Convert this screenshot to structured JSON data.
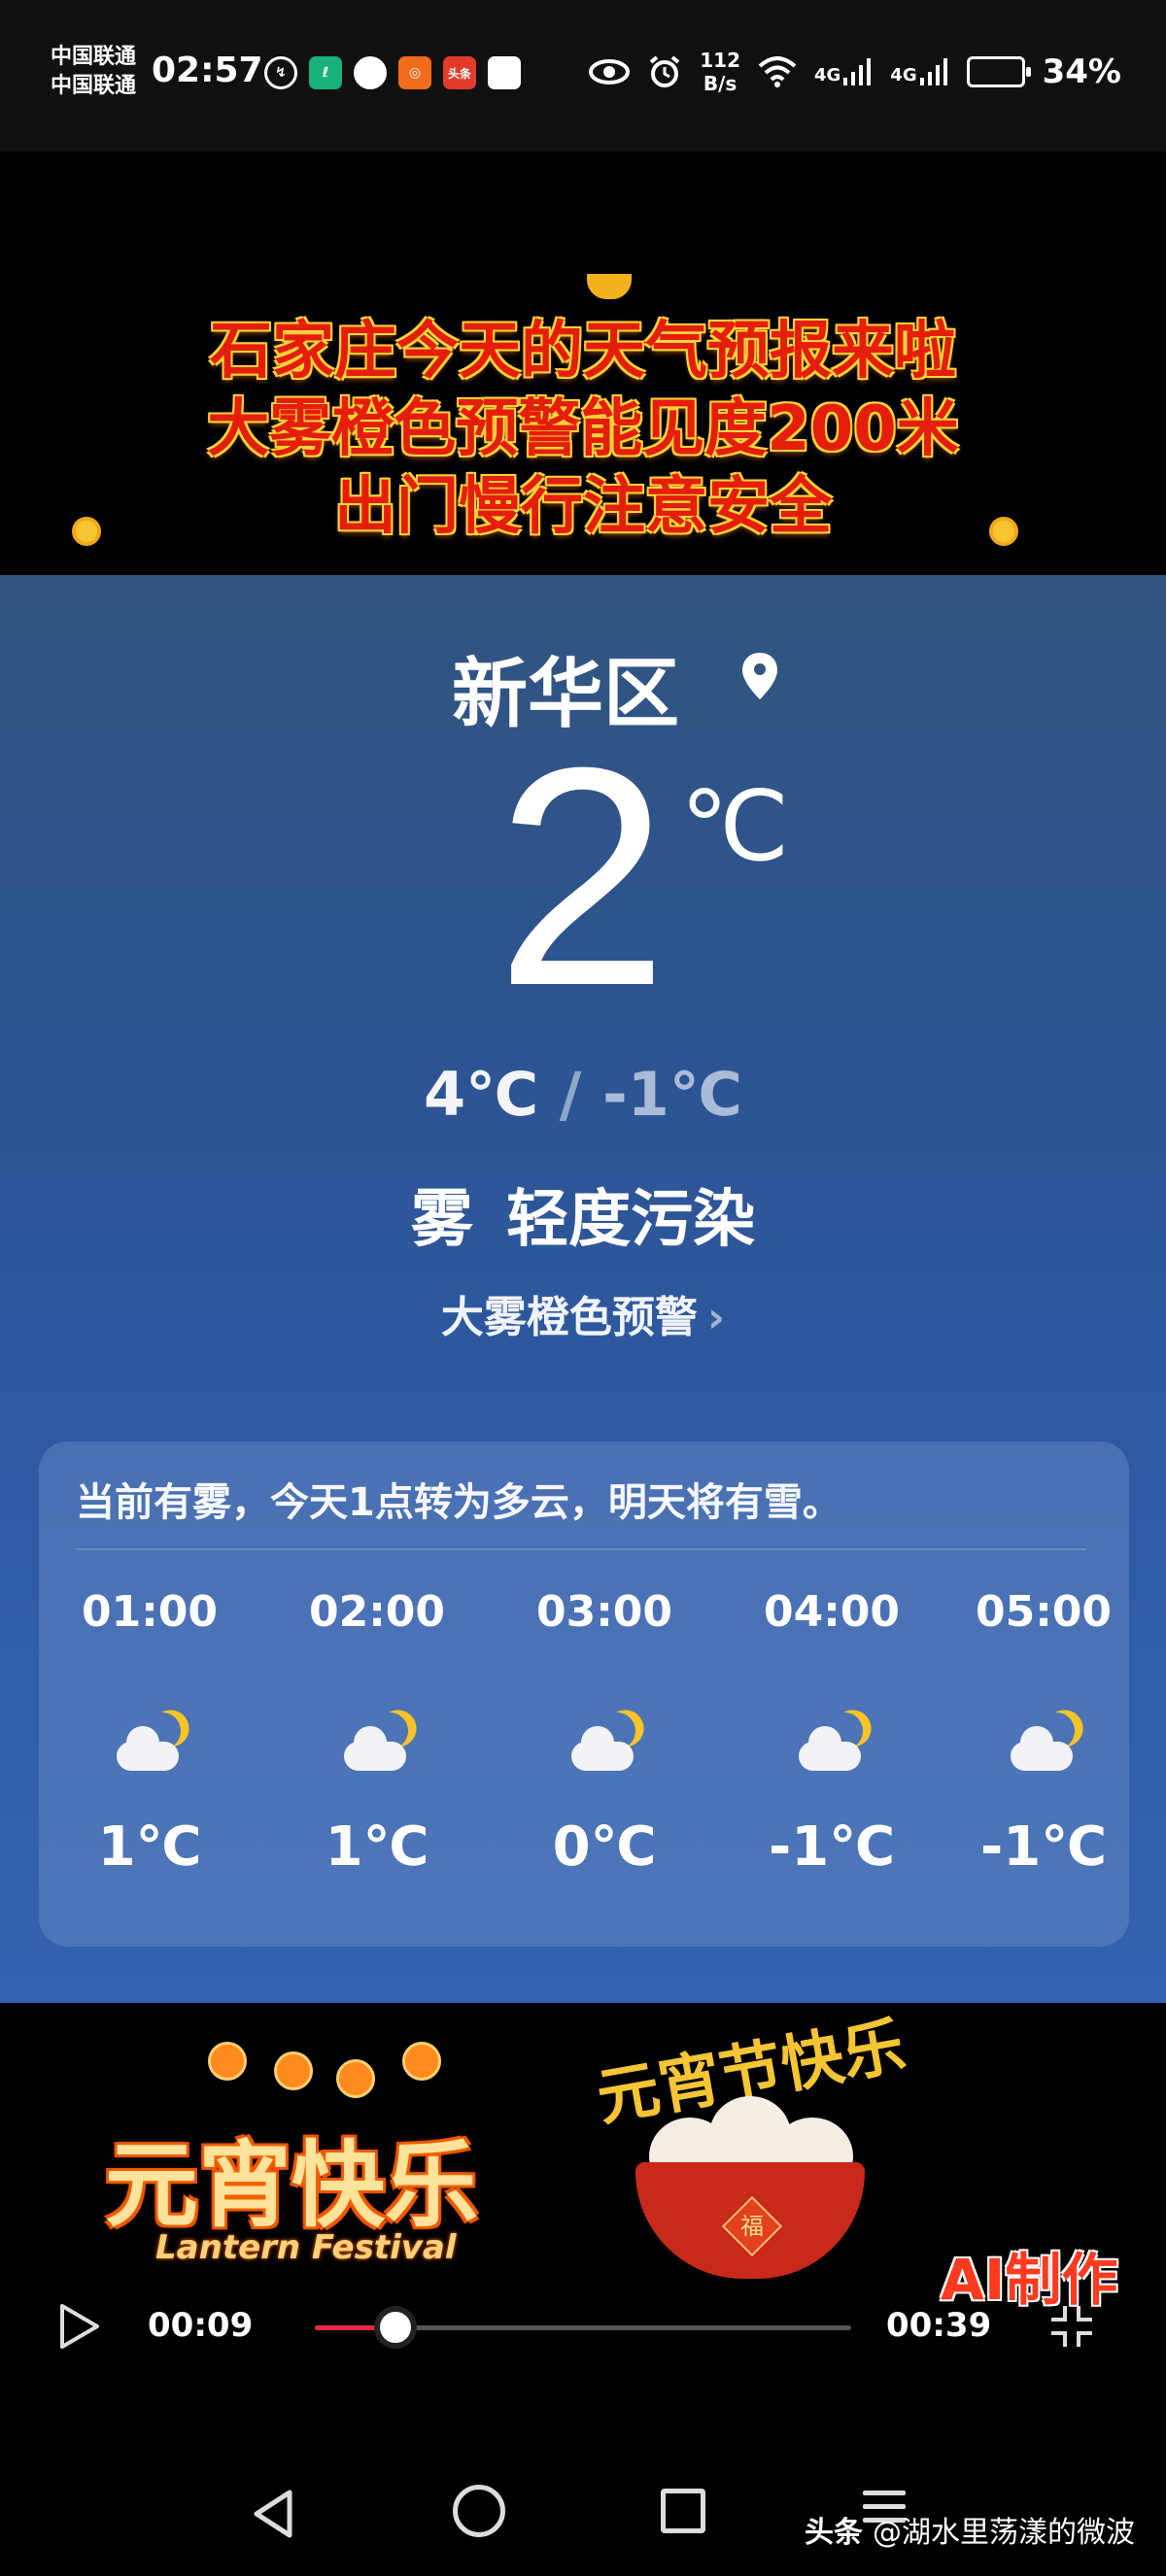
{
  "status_bar": {
    "carrier_1": "中国联通",
    "carrier_2": "中国联通",
    "time": "02:57",
    "net_speed_value": "112",
    "net_speed_unit": "B/s",
    "signal_1": "4G",
    "signal_2": "4G",
    "battery": "34%",
    "notification_icons": [
      "data-saver-icon",
      "app-green-icon",
      "chat-bubble-icon",
      "app-orange-icon",
      "toutiao-icon",
      "bag-icon"
    ],
    "toutiao_icon_text": "头条"
  },
  "top_banner": {
    "lines": [
      "石家庄今天的天气预报来啦",
      "大雾橙色预警能见度200米",
      "出门慢行注意安全"
    ]
  },
  "weather": {
    "location": "新华区",
    "current_temp": "2",
    "temp_unit": "℃",
    "high": "4℃",
    "separator": "/",
    "low": "-1℃",
    "condition": "雾 轻度污染",
    "warning": "大雾橙色预警",
    "warning_chevron": "›",
    "summary": "当前有雾，今天1点转为多云，明天将有雪。",
    "hourly": [
      {
        "time": "01:00",
        "icon": "moon-cloud-icon",
        "temp": "1℃"
      },
      {
        "time": "02:00",
        "icon": "moon-cloud-icon",
        "temp": "1℃"
      },
      {
        "time": "03:00",
        "icon": "moon-cloud-icon",
        "temp": "0℃"
      },
      {
        "time": "04:00",
        "icon": "moon-cloud-icon",
        "temp": "-1℃"
      },
      {
        "time": "05:00",
        "icon": "moon-cloud-icon",
        "temp": "-1℃"
      }
    ]
  },
  "video_banner": {
    "left_title": "元宵快乐",
    "left_subtitle": "Lantern Festival",
    "right_title": "元宵节快乐",
    "bowl_char": "福",
    "ai_badge": "AI制作"
  },
  "player": {
    "current_time": "00:09",
    "total_time": "00:39",
    "progress": 0.15
  },
  "watermark": {
    "app": "头条",
    "author": "@湖水里荡漾的微波"
  },
  "colors": {
    "progress_fill": "#e82848",
    "banner_text": "#e51e0c",
    "moon": "#f6c428"
  }
}
